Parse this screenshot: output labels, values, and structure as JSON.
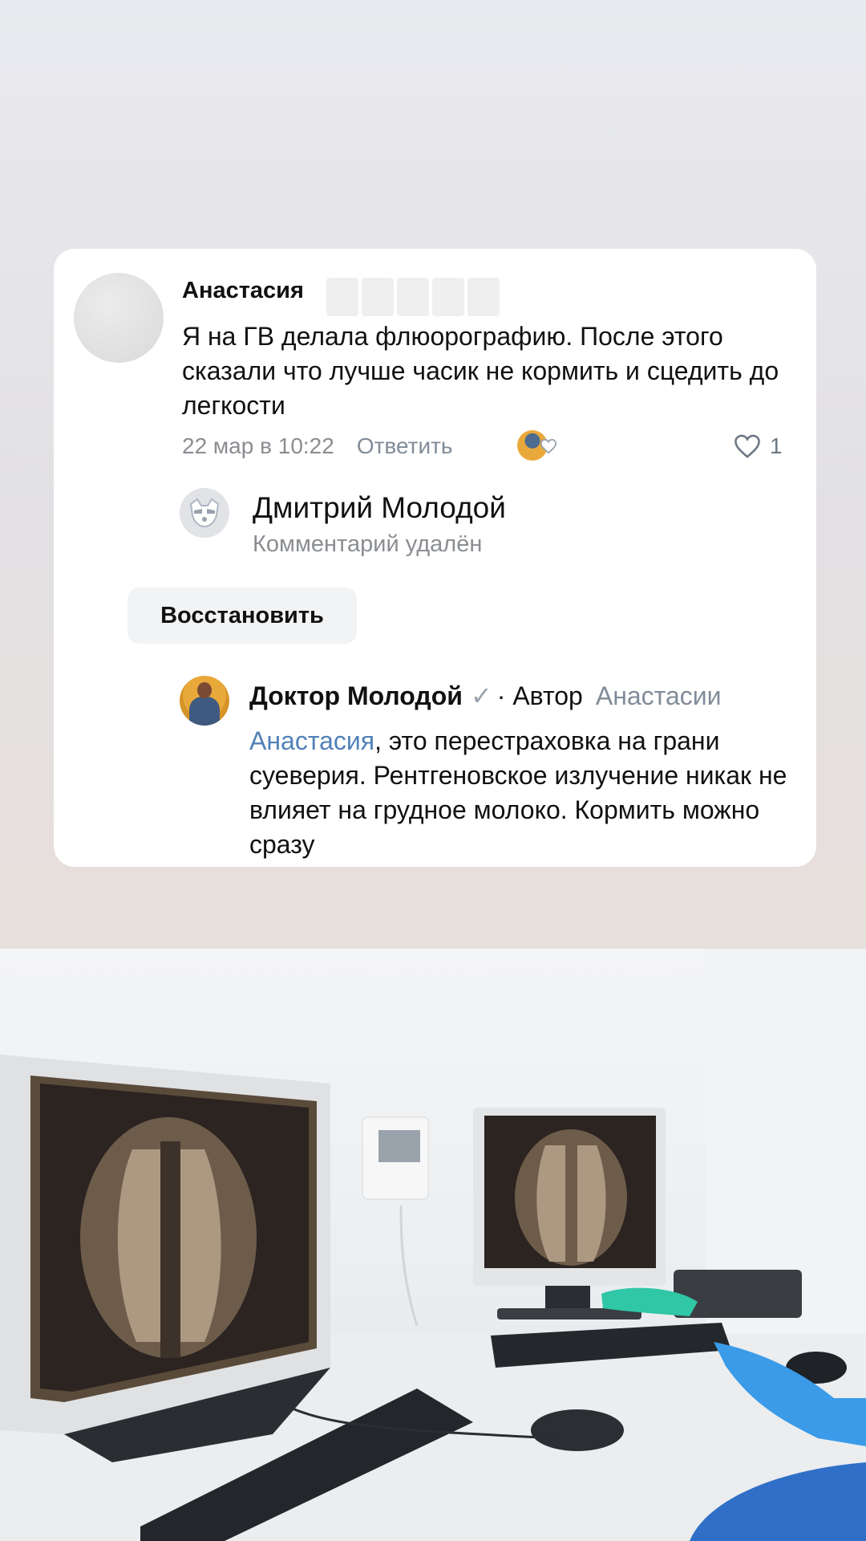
{
  "comment": {
    "author": "Анастасия",
    "text": "Я на ГВ делала флюорографию. После этого сказали что лучше часик не кормить и сцедить до легкости",
    "date": "22 мар в 10:22",
    "reply_label": "Ответить",
    "like_count": "1"
  },
  "deleted_reply": {
    "name": "Дмитрий Молодой",
    "status": "Комментарий удалён",
    "restore_label": "Восстановить"
  },
  "doctor_reply": {
    "name": "Доктор Молодой",
    "verified_mark": "✓",
    "role": "· Автор",
    "reply_to": "Анастасии",
    "mention": "Анастасия",
    "text": ", это перестраховка на грани суеверия. Рентгеновское излучение никак не влияет на грудное молоко. Кормить можно сразу"
  },
  "colors": {
    "link": "#5181b8",
    "secondary_text": "#818c99",
    "card_bg": "#ffffff"
  }
}
